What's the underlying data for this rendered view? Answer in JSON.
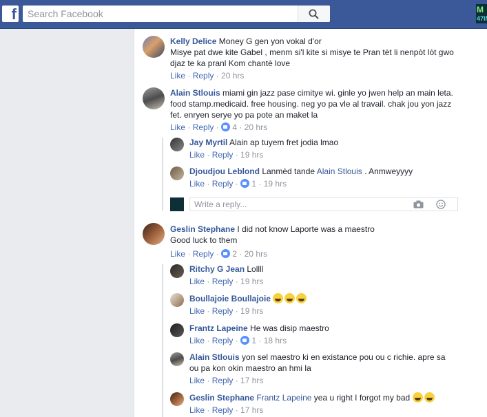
{
  "topbar": {
    "search_placeholder": "Search Facebook",
    "corner_avatar_line1": "M",
    "corner_avatar_line2": "47IN"
  },
  "reply_box": {
    "placeholder": "Write a reply..."
  },
  "actions": {
    "like": "Like",
    "reply": "Reply"
  },
  "comments": [
    {
      "name": "Kelly Delice",
      "text": "Money G gen yon vokal d'or",
      "text2": "Misye pat dwe kite Gabel , menm si'l kite si misye te Pran tèt li nenpòt lòt gwo djaz te ka pranl Kom chantè love",
      "time": "20 hrs"
    },
    {
      "name": "Alain Stlouis",
      "text": "miami gin jazz pase cimitye wi. ginle yo jwen help an main leta. food stamp.medicaid. free housing. neg yo pa vle al travail. chak jou yon jazz fet. enryen serye yo pa pote an maket la",
      "likes": "4",
      "time": "20 hrs",
      "replies": [
        {
          "name": "Jay Myrtil",
          "text": "Alain ap tuyem fret jodia lmao",
          "time": "19 hrs"
        },
        {
          "name": "Djoudjou Leblond",
          "text_before": "Lanmèd tande",
          "mention": "Alain Stlouis",
          "text_after": ". Anmweyyyy",
          "likes": "1",
          "time": "19 hrs"
        }
      ]
    },
    {
      "name": "Geslin Stephane",
      "text": "I did not know Laporte was a maestro",
      "text2": "Good luck to them",
      "likes": "2",
      "time": "20 hrs",
      "replies": [
        {
          "name": "Ritchy G Jean",
          "text": "Lollll",
          "time": "19 hrs"
        },
        {
          "name": "Boullajoie Boullajoie",
          "emoji_count": 3,
          "time": "19 hrs"
        },
        {
          "name": "Frantz Lapeine",
          "text": "He was disip maestro",
          "likes": "1",
          "time": "18 hrs"
        },
        {
          "name": "Alain Stlouis",
          "text": "yon sel maestro ki en existance pou ou c richie. apre sa ou pa kon okin maestro an hmi la",
          "time": "17 hrs"
        },
        {
          "name": "Geslin Stephane",
          "mention": "Frantz Lapeine",
          "text_after": "yea u right I forgot my bad",
          "emoji_count": 2,
          "time": "17 hrs"
        }
      ]
    }
  ]
}
